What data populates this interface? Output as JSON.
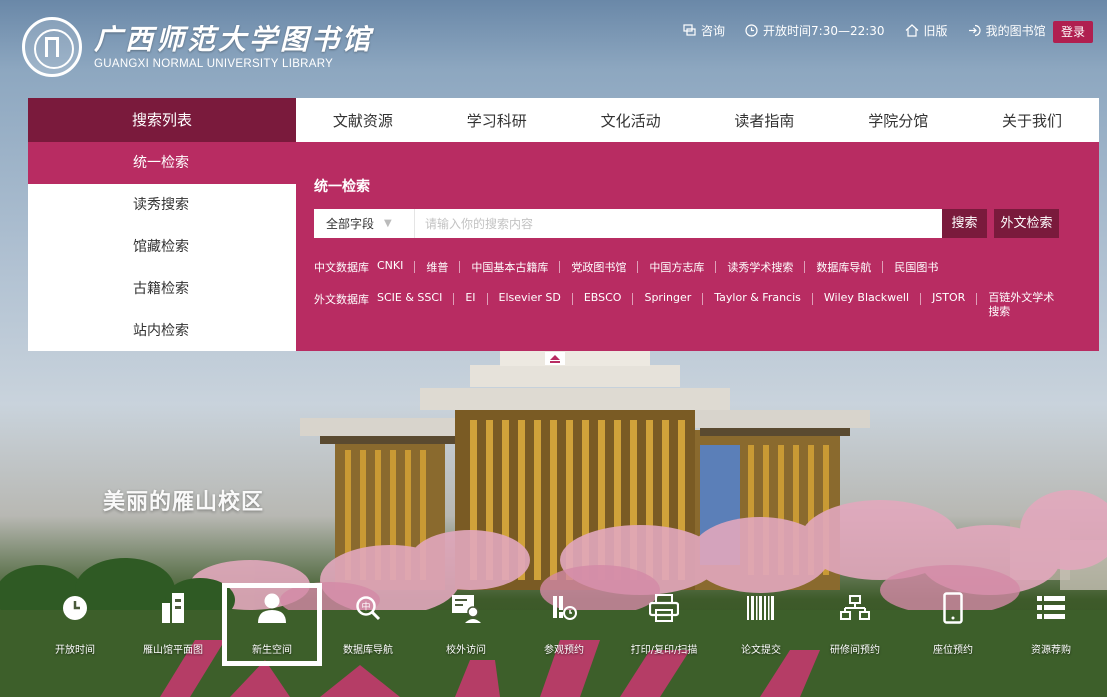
{
  "header": {
    "logo_cn": "广西师范大学图书馆",
    "logo_en": "GUANGXI NORMAL UNIVERSITY LIBRARY",
    "links": [
      {
        "label": "咨询",
        "icon": "chat-icon"
      },
      {
        "label": "开放时间7:30—22:30",
        "icon": "clock-icon"
      },
      {
        "label": "旧版",
        "icon": "home-icon"
      },
      {
        "label": "我的图书馆",
        "icon": "login-arrow-icon"
      }
    ],
    "login_label": "登录"
  },
  "nav": {
    "first": "搜索列表",
    "items": [
      "文献资源",
      "学习科研",
      "文化活动",
      "读者指南",
      "学院分馆",
      "关于我们"
    ]
  },
  "side": {
    "items": [
      "统一检索",
      "读秀搜索",
      "馆藏检索",
      "古籍检索",
      "站内检索"
    ],
    "active_index": 0
  },
  "search": {
    "title": "统一检索",
    "field_select": "全部字段",
    "placeholder": "请输入你的搜索内容",
    "search_button": "搜索",
    "foreign_button": "外文检索"
  },
  "databases": {
    "cn_label": "中文数据库",
    "cn": [
      "CNKI",
      "维普",
      "中国基本古籍库",
      "党政图书馆",
      "中国方志库",
      "读秀学术搜索",
      "数据库导航",
      "民国图书"
    ],
    "en_label": "外文数据库",
    "en": [
      "SCIE & SSCI",
      "EI",
      "Elsevier SD",
      "EBSCO",
      "Springer",
      "Taylor & Francis",
      "Wiley Blackwell",
      "JSTOR",
      "百链外文学术搜索"
    ]
  },
  "campus_title": "美丽的雁山校区",
  "quick_links": [
    {
      "label": "开放时间",
      "icon": "clock-icon"
    },
    {
      "label": "雁山馆平面图",
      "icon": "building-icon"
    },
    {
      "label": "新生空间",
      "icon": "user-icon"
    },
    {
      "label": "数据库导航",
      "icon": "database-search-icon"
    },
    {
      "label": "校外访问",
      "icon": "remote-access-icon"
    },
    {
      "label": "参观预约",
      "icon": "visit-calendar-icon"
    },
    {
      "label": "打印/复印/扫描",
      "icon": "printer-icon"
    },
    {
      "label": "论文提交",
      "icon": "barcode-icon"
    },
    {
      "label": "研修间预约",
      "icon": "sitemap-icon"
    },
    {
      "label": "座位预约",
      "icon": "mobile-icon"
    },
    {
      "label": "资源荐购",
      "icon": "list-icon"
    }
  ],
  "highlighted_quick_link_index": 2,
  "colors": {
    "brand": "#b82c62",
    "brand_dark": "#7a1a3c",
    "login": "#b01f50"
  }
}
